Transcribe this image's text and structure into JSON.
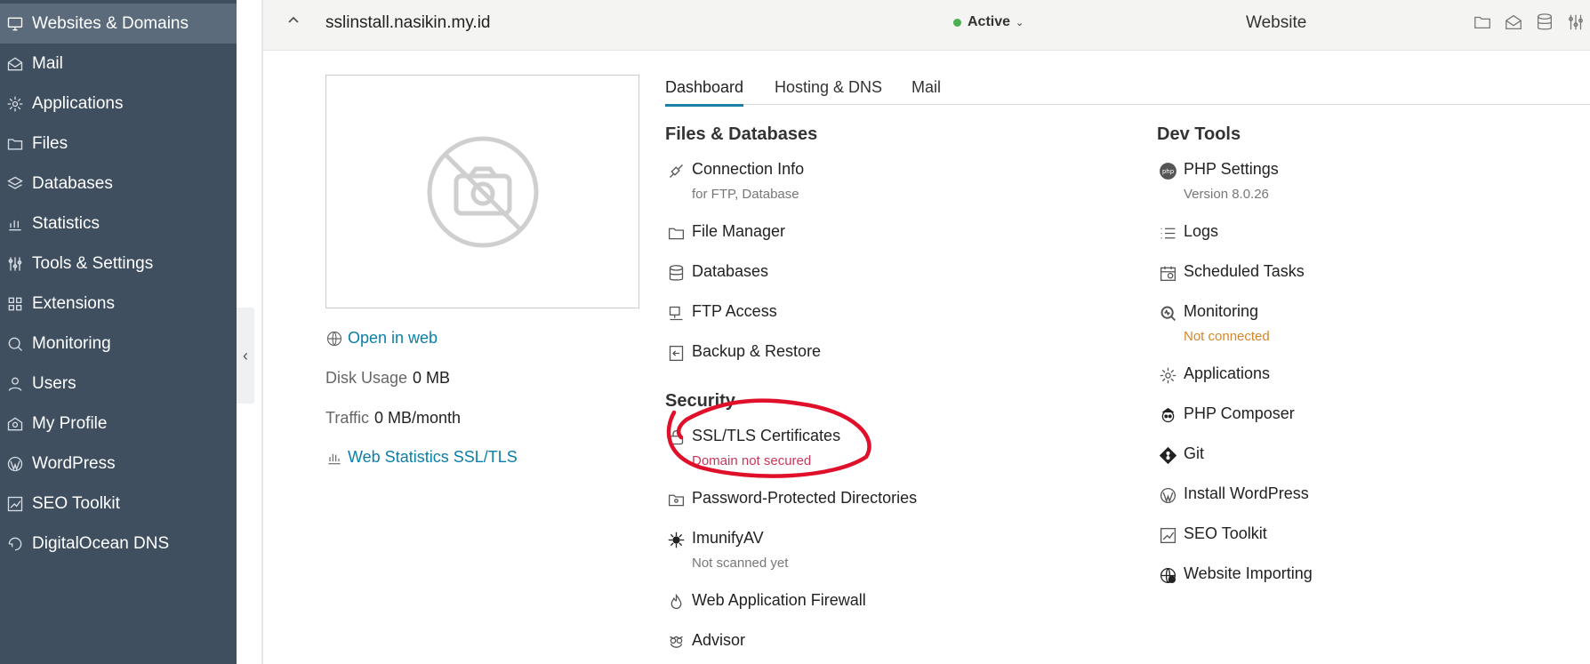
{
  "sidebar": {
    "items": [
      {
        "label": "Websites & Domains",
        "icon": "monitor-icon"
      },
      {
        "label": "Mail",
        "icon": "mail-icon"
      },
      {
        "label": "Applications",
        "icon": "gear-icon"
      },
      {
        "label": "Files",
        "icon": "folder-icon"
      },
      {
        "label": "Databases",
        "icon": "layers-icon"
      },
      {
        "label": "Statistics",
        "icon": "bar-chart-icon"
      },
      {
        "label": "Tools & Settings",
        "icon": "sliders-icon"
      },
      {
        "label": "Extensions",
        "icon": "grid-icon"
      },
      {
        "label": "Monitoring",
        "icon": "monitor-search-icon"
      },
      {
        "label": "Users",
        "icon": "user-icon"
      },
      {
        "label": "My Profile",
        "icon": "profile-icon"
      },
      {
        "label": "WordPress",
        "icon": "wordpress-icon"
      },
      {
        "label": "SEO Toolkit",
        "icon": "seo-icon"
      },
      {
        "label": "DigitalOcean DNS",
        "icon": "dns-icon"
      }
    ]
  },
  "header": {
    "domain": "sslinstall.nasikin.my.id",
    "status": "Active",
    "type": "Website"
  },
  "summary": {
    "open_in_web": "Open in web",
    "disk_label": "Disk Usage",
    "disk_value": "0 MB",
    "traffic_label": "Traffic",
    "traffic_value": "0 MB/month",
    "web_stats": "Web Statistics SSL/TLS"
  },
  "tabs": [
    "Dashboard",
    "Hosting & DNS",
    "Mail"
  ],
  "files_db": {
    "title": "Files & Databases",
    "connection": "Connection Info",
    "connection_sub": "for FTP, Database",
    "file_manager": "File Manager",
    "databases": "Databases",
    "ftp": "FTP Access",
    "backup": "Backup & Restore"
  },
  "security": {
    "title": "Security",
    "ssl": "SSL/TLS Certificates",
    "ssl_sub": "Domain not secured",
    "pwd_dirs": "Password-Protected Directories",
    "imunify": "ImunifyAV",
    "imunify_sub": "Not scanned yet",
    "waf": "Web Application Firewall",
    "advisor": "Advisor"
  },
  "dev": {
    "title": "Dev Tools",
    "php": "PHP Settings",
    "php_sub": "Version 8.0.26",
    "logs": "Logs",
    "tasks": "Scheduled Tasks",
    "monitoring": "Monitoring",
    "monitoring_sub": "Not connected",
    "apps": "Applications",
    "composer": "PHP Composer",
    "git": "Git",
    "wp": "Install WordPress",
    "seo": "SEO Toolkit",
    "importing": "Website Importing"
  },
  "colors": {
    "sidebar_bg": "#3f4f60",
    "link": "#0b7fa6",
    "status_green": "#4caf50",
    "error_red": "#c8375a",
    "warning_orange": "#d4862a",
    "annotation_red": "#e0102a"
  }
}
